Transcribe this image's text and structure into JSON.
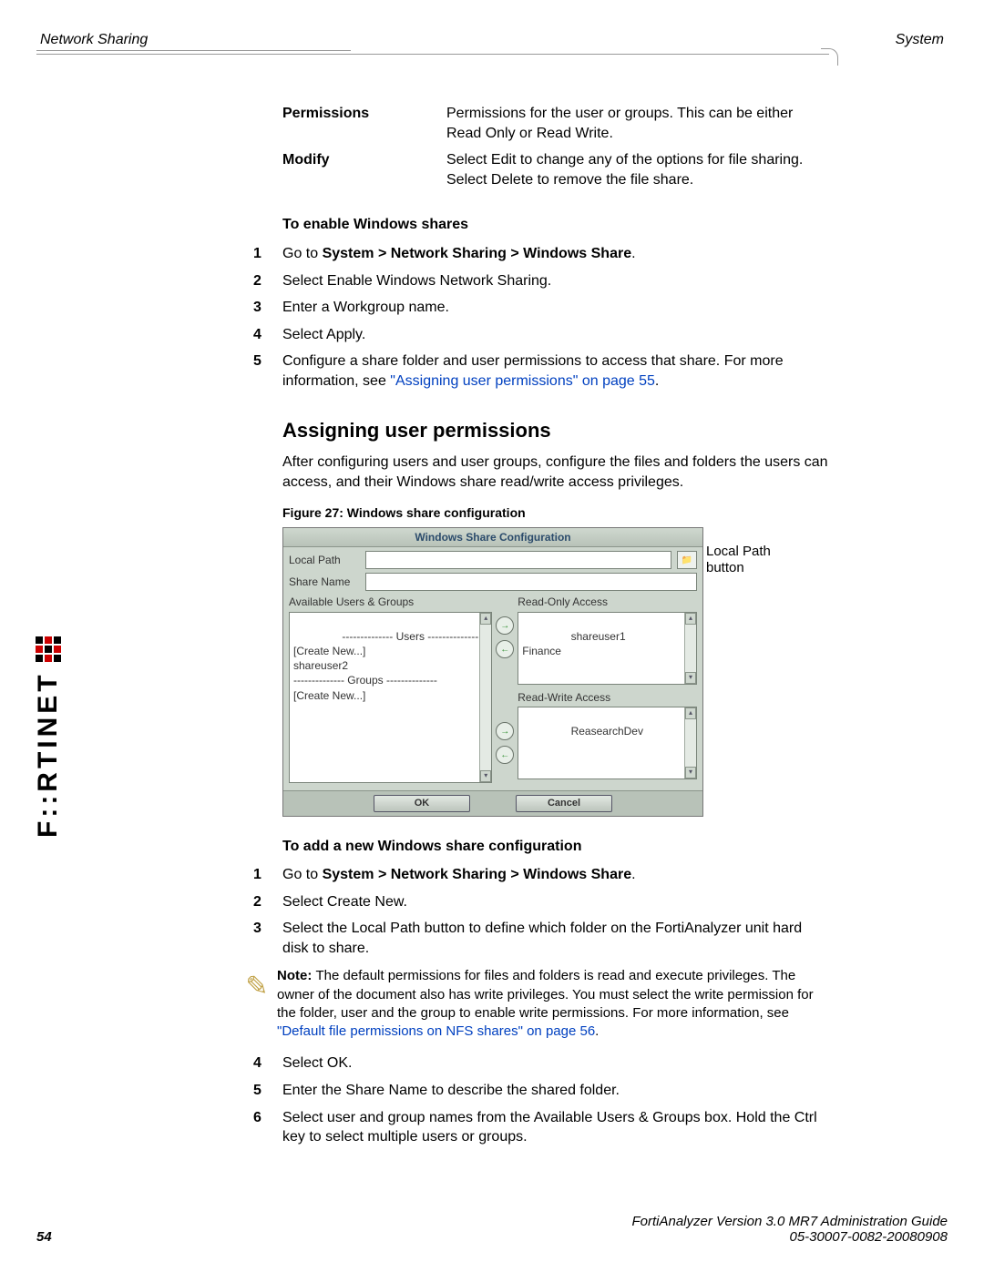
{
  "header": {
    "left": "Network Sharing",
    "right": "System"
  },
  "definitions": [
    {
      "term": "Permissions",
      "desc": "Permissions for the user or groups. This can be either Read Only or Read Write."
    },
    {
      "term": "Modify",
      "desc": "Select Edit to change any of the options for file sharing. Select Delete to remove the file share."
    }
  ],
  "section1": {
    "heading": "To enable Windows shares",
    "steps": [
      {
        "n": "1",
        "pre": "Go to ",
        "boldpath": "System > Network Sharing > Windows Share",
        "post": "."
      },
      {
        "n": "2",
        "text": "Select Enable Windows Network Sharing."
      },
      {
        "n": "3",
        "text": "Enter a Workgroup name."
      },
      {
        "n": "4",
        "text": "Select Apply."
      },
      {
        "n": "5",
        "text_a": "Configure a share folder and user permissions to access that share. For more information, see ",
        "link": "\"Assigning user permissions\" on page 55",
        "text_b": "."
      }
    ]
  },
  "h2": "Assigning user permissions",
  "intro": "After configuring users and user groups, configure the files and folders the users can access, and their Windows share read/write access privileges.",
  "figure": {
    "caption": "Figure 27: Windows share configuration",
    "callout": "Local Path button",
    "dialog": {
      "title": "Windows Share Configuration",
      "local_path_label": "Local Path",
      "share_name_label": "Share Name",
      "avail_label": "Available Users & Groups",
      "ro_label": "Read-Only Access",
      "rw_label": "Read-Write Access",
      "avail_list": "-------------- Users --------------\n[Create New...]\nshareuser2\n-------------- Groups --------------\n[Create New...]",
      "ro_list": "shareuser1\nFinance",
      "rw_list": "ReasearchDev",
      "ok": "OK",
      "cancel": "Cancel"
    }
  },
  "section2": {
    "heading": "To add a new Windows share configuration",
    "steps_a": [
      {
        "n": "1",
        "pre": "Go to ",
        "boldpath": "System > Network Sharing > Windows Share",
        "post": "."
      },
      {
        "n": "2",
        "text": "Select Create New."
      },
      {
        "n": "3",
        "text": "Select the Local Path button to define which folder on the FortiAnalyzer unit hard disk to share."
      }
    ],
    "note_pre": "Note: ",
    "note_text_a": "The default permissions for files and folders is read and execute privileges. The owner of the document also has write privileges. You must select the write permission for the folder, user and the group to enable write permissions. For more information, see ",
    "note_link": "\"Default file permissions on NFS shares\" on page 56",
    "note_post": ".",
    "steps_b": [
      {
        "n": "4",
        "text": "Select OK."
      },
      {
        "n": "5",
        "text": "Enter the Share Name to describe the shared folder."
      },
      {
        "n": "6",
        "text": "Select user and group names from the Available Users & Groups box. Hold the Ctrl key to select multiple users or groups."
      }
    ]
  },
  "footer": {
    "line1": "FortiAnalyzer Version 3.0 MR7 Administration Guide",
    "line2": "05-30007-0082-20080908",
    "page": "54"
  },
  "brand": "F::RTINET"
}
